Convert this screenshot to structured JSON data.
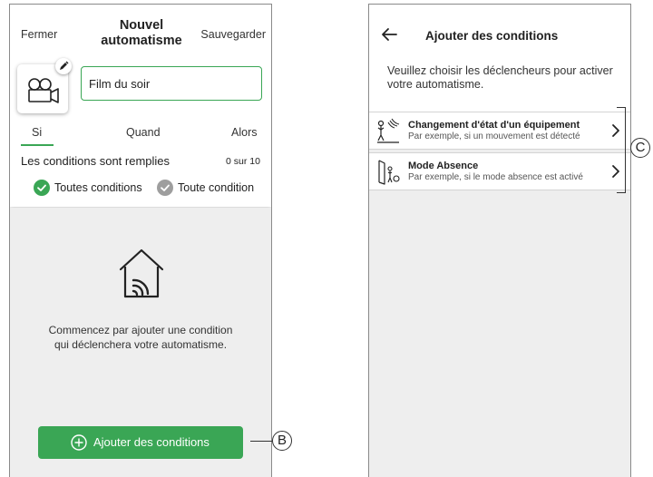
{
  "left_screen": {
    "header": {
      "close_label": "Fermer",
      "title_line1": "Nouvel",
      "title_line2": "automatisme",
      "save_label": "Sauvegarder"
    },
    "name_field_value": "Film du soir",
    "tabs": [
      {
        "label": "Si",
        "active": true
      },
      {
        "label": "Quand",
        "active": false
      },
      {
        "label": "Alors",
        "active": false
      }
    ],
    "conditions": {
      "status_text": "Les conditions sont remplies",
      "count_text": "0 sur 10"
    },
    "match_options": [
      {
        "label": "Toutes conditions",
        "selected": true,
        "color": "#3aa655"
      },
      {
        "label": "Toute condition",
        "selected": false,
        "color": "#9e9e9e"
      }
    ],
    "empty_state": {
      "icon": "smart-home-icon",
      "line1": "Commencez par ajouter une condition",
      "line2": "qui déclenchera votre automatisme."
    },
    "add_button_label": "Ajouter des conditions"
  },
  "right_screen": {
    "title": "Ajouter des conditions",
    "instructions": "Veuillez choisir les déclencheurs pour activer votre automatisme.",
    "options": [
      {
        "title": "Changement d'état d'un équipement",
        "subtitle": "Par exemple, si un mouvement est détecté",
        "icon": "motion-sensor-icon"
      },
      {
        "title": "Mode Absence",
        "subtitle": "Par exemple, si le mode absence est activé",
        "icon": "away-mode-icon"
      }
    ]
  },
  "callouts": {
    "b": "B",
    "c": "C"
  },
  "colors": {
    "accent": "#3aa655",
    "panel_bg": "#eeeeee",
    "unselected": "#9e9e9e"
  }
}
